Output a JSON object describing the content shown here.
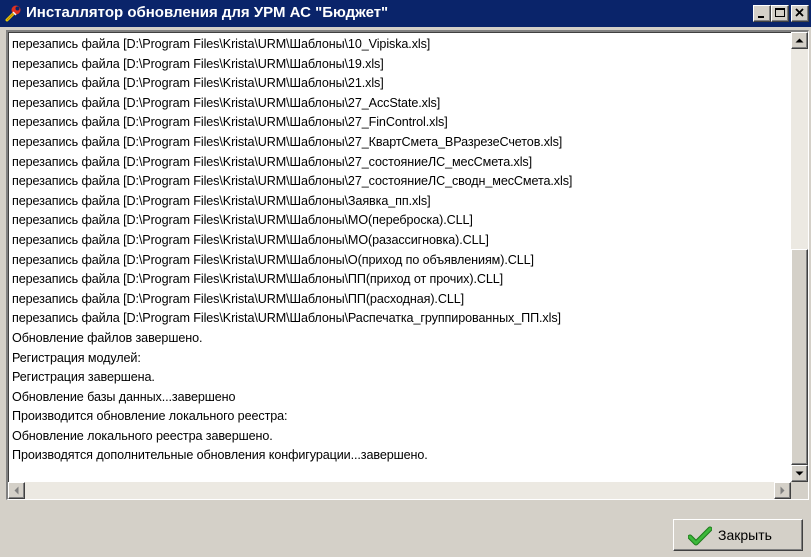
{
  "window": {
    "title": "Инсталлятор обновления для УРМ АС \"Бюджет\"",
    "icon": "installer-wrench-icon",
    "title_bar_color": "#0a246a"
  },
  "caption_buttons": [
    "minimize-icon",
    "maximize-icon",
    "close-icon"
  ],
  "log": {
    "lines": [
      "перезапись файла [D:\\Program Files\\Krista\\URM\\Шаблоны\\10_Vipiska.xls]",
      "перезапись файла [D:\\Program Files\\Krista\\URM\\Шаблоны\\19.xls]",
      "перезапись файла [D:\\Program Files\\Krista\\URM\\Шаблоны\\21.xls]",
      "перезапись файла [D:\\Program Files\\Krista\\URM\\Шаблоны\\27_AccState.xls]",
      "перезапись файла [D:\\Program Files\\Krista\\URM\\Шаблоны\\27_FinControl.xls]",
      "перезапись файла [D:\\Program Files\\Krista\\URM\\Шаблоны\\27_КвартСмета_ВРазрезеСчетов.xls]",
      "перезапись файла [D:\\Program Files\\Krista\\URM\\Шаблоны\\27_состояниеЛС_месСмета.xls]",
      "перезапись файла [D:\\Program Files\\Krista\\URM\\Шаблоны\\27_состояниеЛС_сводн_месСмета.xls]",
      "перезапись файла [D:\\Program Files\\Krista\\URM\\Шаблоны\\Заявка_пп.xls]",
      "перезапись файла [D:\\Program Files\\Krista\\URM\\Шаблоны\\МО(переброска).CLL]",
      "перезапись файла [D:\\Program Files\\Krista\\URM\\Шаблоны\\МО(разассигновка).CLL]",
      "перезапись файла [D:\\Program Files\\Krista\\URM\\Шаблоны\\О(приход по объявлениям).CLL]",
      "перезапись файла [D:\\Program Files\\Krista\\URM\\Шаблоны\\ПП(приход от прочих).CLL]",
      "перезапись файла [D:\\Program Files\\Krista\\URM\\Шаблоны\\ПП(расходная).CLL]",
      "перезапись файла [D:\\Program Files\\Krista\\URM\\Шаблоны\\Распечатка_группированных_ПП.xls]",
      "Обновление файлов завершено.",
      "Регистрация модулей:",
      "Регистрация завершена.",
      "Обновление базы данных...завершено",
      "Производится обновление локального реестра:",
      "Обновление локального реестра завершено.",
      "Производятся дополнительные обновления конфигурации...завершено."
    ],
    "vertical_scroll_fraction": 1.0,
    "horizontal_scroll_fraction": 0.0
  },
  "close_button": {
    "label": "Закрыть",
    "icon": "checkmark-icon",
    "icon_color": "#2e9a2a"
  }
}
